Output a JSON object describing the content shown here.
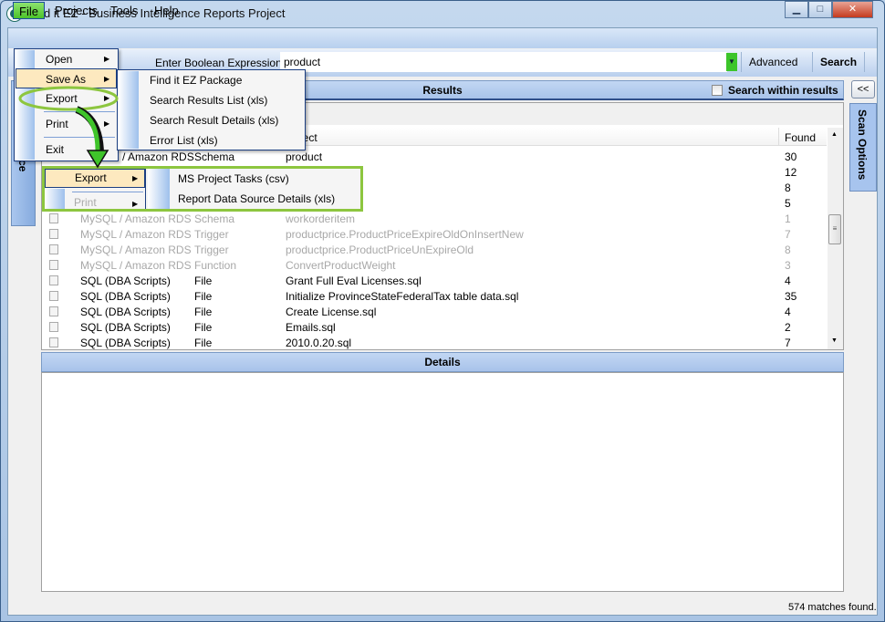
{
  "window": {
    "title": "Find it EZ - Business Intelligence Reports Project",
    "minimize": "▁",
    "maximize": "□",
    "close": "✕"
  },
  "menubar": [
    "File",
    "Projects",
    "Tools",
    "Help"
  ],
  "toolbar": {
    "expr_label": "Enter Boolean Expression:",
    "expr_value": "product",
    "advanced": "Advanced",
    "search": "Search"
  },
  "left_panel": {
    "label": "ce"
  },
  "results": {
    "title": "Results",
    "search_within": "Search within results",
    "collapse": "<<"
  },
  "scan_options": "Scan Options",
  "grid": {
    "columns": [
      "",
      "",
      "Object",
      "Found"
    ],
    "rows": [
      {
        "source": "/ Amazon RDS",
        "type": "Schema",
        "object": "product",
        "found": "30",
        "faded": false
      },
      {
        "source": "",
        "type": "",
        "object": "",
        "found": "12",
        "faded": false
      },
      {
        "source": "",
        "type": "",
        "object": "",
        "found": "8",
        "faded": false
      },
      {
        "source": "",
        "type": "",
        "object": "",
        "found": "5",
        "faded": false
      },
      {
        "source": "MySQL / Amazon RDS",
        "type": "Schema",
        "object": "workorderitem",
        "found": "1",
        "faded": true
      },
      {
        "source": "MySQL / Amazon RDS",
        "type": "Trigger",
        "object": "productprice.ProductPriceExpireOldOnInsertNew",
        "found": "7",
        "faded": true
      },
      {
        "source": "MySQL / Amazon RDS",
        "type": "Trigger",
        "object": "productprice.ProductPriceUnExpireOld",
        "found": "8",
        "faded": true
      },
      {
        "source": "MySQL / Amazon RDS",
        "type": "Function",
        "object": "ConvertProductWeight",
        "found": "3",
        "faded": true
      },
      {
        "source": "SQL (DBA Scripts)",
        "type": "File",
        "object": "Grant Full Eval Licenses.sql",
        "found": "4",
        "faded": false
      },
      {
        "source": "SQL (DBA Scripts)",
        "type": "File",
        "object": "Initialize ProvinceStateFederalTax table data.sql",
        "found": "35",
        "faded": false
      },
      {
        "source": "SQL (DBA Scripts)",
        "type": "File",
        "object": "Create License.sql",
        "found": "4",
        "faded": false
      },
      {
        "source": "SQL (DBA Scripts)",
        "type": "File",
        "object": "Emails.sql",
        "found": "2",
        "faded": false
      },
      {
        "source": "SQL (DBA Scripts)",
        "type": "File",
        "object": "2010.0.20.sql",
        "found": "7",
        "faded": false
      }
    ]
  },
  "details": {
    "title": "Details"
  },
  "status": "574 matches found.",
  "file_menu": [
    "Open",
    "Save As",
    "Export",
    "Print",
    "Exit"
  ],
  "save_as_menu": [
    "Find it EZ Package",
    "Search Results List (xls)",
    "Search Result Details (xls)",
    "Error List (xls)"
  ],
  "callout": {
    "export": "Export",
    "print": "Print",
    "items": [
      "MS Project Tasks (csv)",
      "Report Data Source Details (xls)"
    ]
  },
  "colors": {
    "highlight_green": "#8dc63f",
    "menu_highlight": "#fde9bf",
    "header_blue": "#a8c3ea"
  }
}
